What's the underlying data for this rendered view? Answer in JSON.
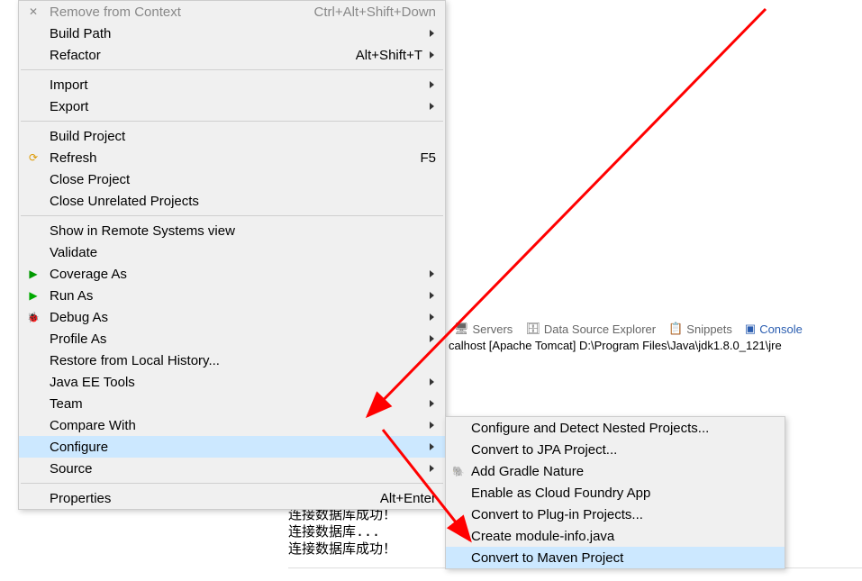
{
  "main_menu": {
    "items": [
      {
        "label": "Remove from Context",
        "shortcut": "Ctrl+Alt+Shift+Down",
        "disabled": true
      },
      {
        "label": "Build Path",
        "submenu": true
      },
      {
        "label": "Refactor",
        "shortcut": "Alt+Shift+T",
        "submenu": true
      },
      {
        "sep": true
      },
      {
        "label": "Import",
        "submenu": true
      },
      {
        "label": "Export",
        "submenu": true
      },
      {
        "sep": true
      },
      {
        "label": "Build Project"
      },
      {
        "label": "Refresh",
        "shortcut": "F5"
      },
      {
        "label": "Close Project"
      },
      {
        "label": "Close Unrelated Projects"
      },
      {
        "sep": true
      },
      {
        "label": "Show in Remote Systems view"
      },
      {
        "label": "Validate"
      },
      {
        "label": "Coverage As",
        "submenu": true,
        "icon": "coverage"
      },
      {
        "label": "Run As",
        "submenu": true,
        "icon": "run"
      },
      {
        "label": "Debug As",
        "submenu": true,
        "icon": "debug"
      },
      {
        "label": "Profile As",
        "submenu": true
      },
      {
        "label": "Restore from Local History..."
      },
      {
        "label": "Java EE Tools",
        "submenu": true
      },
      {
        "label": "Team",
        "submenu": true
      },
      {
        "label": "Compare With",
        "submenu": true
      },
      {
        "label": "Configure",
        "submenu": true,
        "highlight": true
      },
      {
        "label": "Source",
        "submenu": true
      },
      {
        "sep": true
      },
      {
        "label": "Properties",
        "shortcut": "Alt+Enter"
      }
    ]
  },
  "submenu": {
    "items": [
      {
        "label": "Configure and Detect Nested Projects..."
      },
      {
        "label": "Convert to JPA Project..."
      },
      {
        "label": "Add Gradle Nature",
        "icon": "gradle"
      },
      {
        "label": "Enable as Cloud Foundry App"
      },
      {
        "label": "Convert to Plug-in Projects..."
      },
      {
        "label": "Create module-info.java"
      },
      {
        "label": "Convert to Maven Project",
        "highlight": true
      }
    ]
  },
  "tabs": {
    "servers": {
      "label": "Servers",
      "icon": "server"
    },
    "dse": {
      "label": "Data Source Explorer",
      "icon": "db"
    },
    "snippets": {
      "label": "Snippets",
      "icon": "snip"
    },
    "console": {
      "label": "Console",
      "icon": "console"
    }
  },
  "status_line": "calhost [Apache Tomcat] D:\\Program Files\\Java\\jdk1.8.0_121\\jre",
  "console_lines": [
    "连接数据库...",
    "连接数据库成功！",
    "连接数据库...",
    "连接数据库成功！"
  ],
  "icons": {
    "refresh_glyph": "⟳",
    "coverage_glyph": "▶",
    "run_glyph": "▶",
    "debug_glyph": "🐞",
    "gradle_glyph": "🐘",
    "server_glyph": "🖥",
    "db_glyph": "🗄",
    "snip_glyph": "📋",
    "console_glyph": "▣"
  }
}
